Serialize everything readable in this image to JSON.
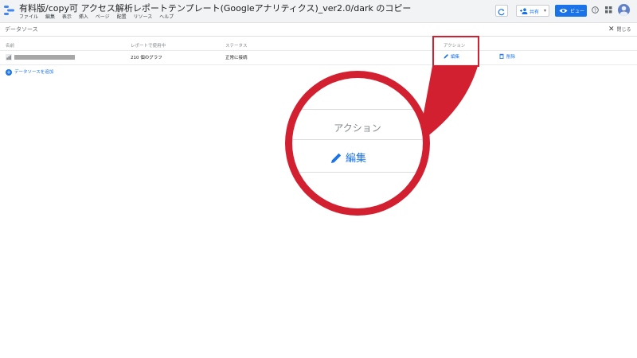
{
  "header": {
    "title": "有料版/copy可 アクセス解析レポートテンプレート(Googleアナリティクス)_ver2.0/dark のコピー",
    "menu": [
      "ファイル",
      "編集",
      "表示",
      "挿入",
      "ページ",
      "配置",
      "リソース",
      "ヘルプ"
    ],
    "share_label": "共有",
    "view_label": "ビュー"
  },
  "panel": {
    "title": "データソース",
    "close_label": "閉じる"
  },
  "table": {
    "columns": {
      "name": "名前",
      "usage": "レポートで使用中",
      "status": "ステータス",
      "actions": "アクション"
    },
    "rows": [
      {
        "usage": "210 個のグラフ",
        "status": "正常に接続",
        "edit": "編集",
        "delete": "削除"
      }
    ],
    "add_source_label": "データソースを追加"
  },
  "zoom": {
    "actions_label": "アクション",
    "edit_label": "編集"
  },
  "colors": {
    "accent": "#1a73e8",
    "callout": "#d32030",
    "header_bg": "#f1f3f4"
  }
}
